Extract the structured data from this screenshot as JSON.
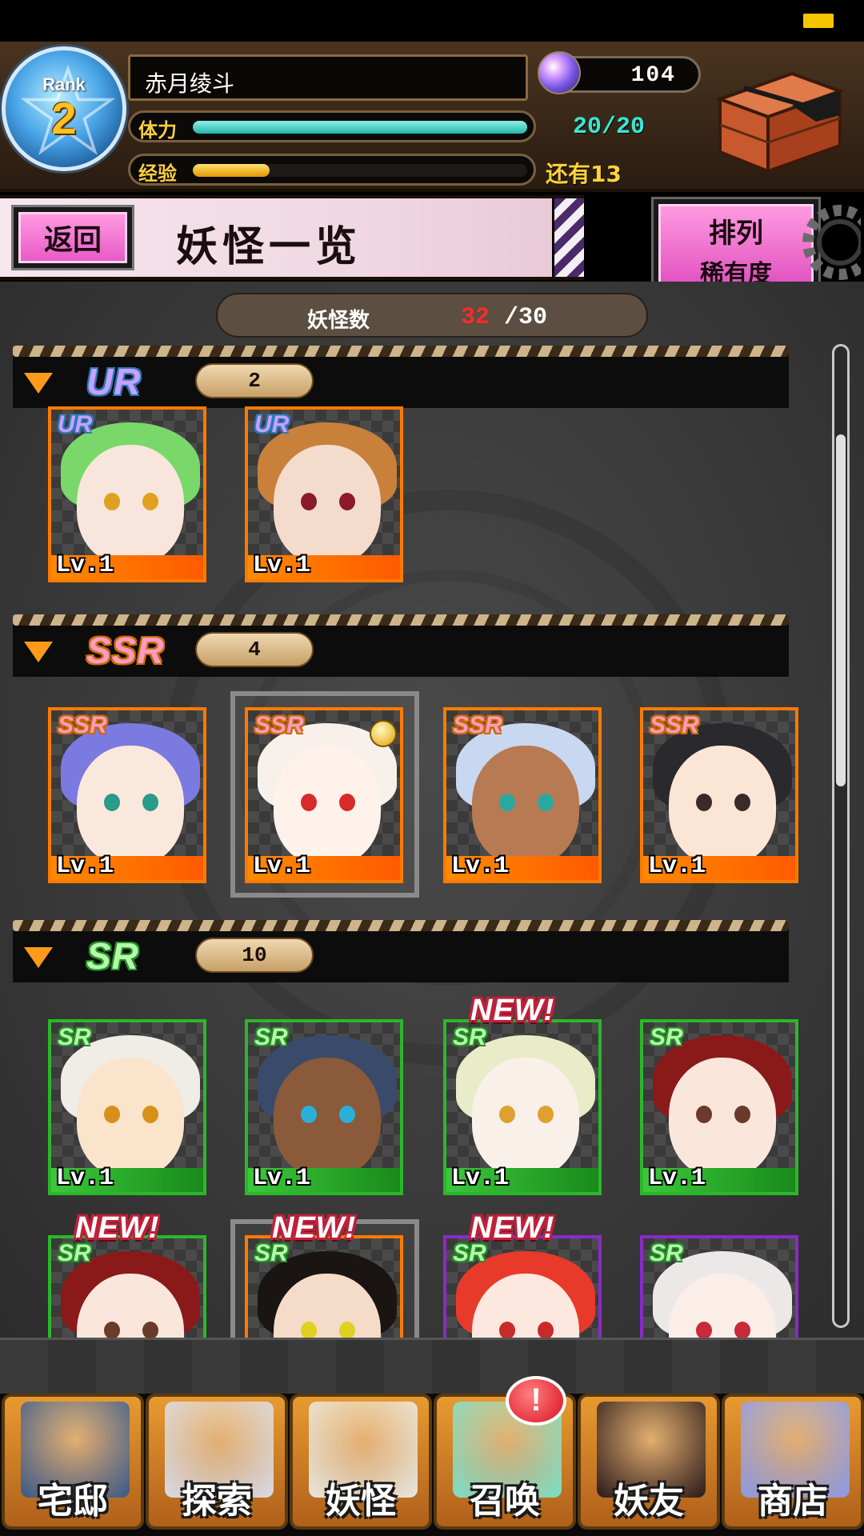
{
  "header": {
    "rank_label": "Rank",
    "rank_value": "2",
    "player_name": "赤月绫斗",
    "gems": "104",
    "stamina_label": "体力",
    "stamina_value": "20/20",
    "stamina_fraction": 1.0,
    "exp_label": "经验",
    "exp_remaining": "还有13",
    "exp_fraction": 0.23
  },
  "title_bar": {
    "back_label": "返回",
    "title": "妖怪一览",
    "sort_label": "排列",
    "sort_value": "稀有度"
  },
  "monster_count": {
    "label": "妖怪数",
    "current": "32",
    "max": "/30"
  },
  "sections": [
    {
      "rarity": "UR",
      "count": "2",
      "cards": [
        {
          "rarity": "UR",
          "level": "Lv.1",
          "hair": "#7ad86a",
          "skin": "#f8e6dc",
          "eye": "#e0a020"
        },
        {
          "rarity": "UR",
          "level": "Lv.1",
          "hair": "#c8803a",
          "skin": "#f4dccc",
          "eye": "#8a1a2a"
        }
      ]
    },
    {
      "rarity": "SSR",
      "count": "4",
      "cards": [
        {
          "rarity": "SSR",
          "level": "Lv.1",
          "hair": "#7a7ae0",
          "skin": "#fbe8dc",
          "eye": "#2a9a8a"
        },
        {
          "rarity": "SSR",
          "level": "Lv.1",
          "hair": "#f8f0ea",
          "skin": "#fff2ea",
          "eye": "#d82a2a"
        },
        {
          "rarity": "SSR",
          "level": "Lv.1",
          "hair": "#c8d8f0",
          "skin": "#b87a52",
          "eye": "#2aa8a0"
        },
        {
          "rarity": "SSR",
          "level": "Lv.1",
          "hair": "#2a2a2e",
          "skin": "#fbe6d6",
          "eye": "#3a2a2a"
        }
      ]
    },
    {
      "rarity": "SR",
      "count": "10",
      "cards": [
        {
          "rarity": "SR",
          "level": "Lv.1",
          "hair": "#f0ece6",
          "skin": "#fbe4cc",
          "eye": "#d8901a"
        },
        {
          "rarity": "SR",
          "level": "Lv.1",
          "hair": "#3a4a6a",
          "skin": "#8a5a3a",
          "eye": "#2ab0d8"
        },
        {
          "rarity": "SR",
          "level": "Lv.1",
          "hair": "#e8ecc8",
          "skin": "#faf0ea",
          "eye": "#e0a030"
        },
        {
          "rarity": "SR",
          "level": "Lv.1",
          "hair": "#8a1a1a",
          "skin": "#fbe6dc",
          "eye": "#6a3a2a"
        },
        {
          "rarity": "SR",
          "level": "",
          "hair": "#8a1a1a",
          "skin": "#fbe6dc",
          "eye": "#6a3a2a"
        },
        {
          "rarity": "SR",
          "level": "",
          "hair": "#1a1412",
          "skin": "#f4dcc8",
          "eye": "#e0d020"
        },
        {
          "rarity": "SR",
          "level": "",
          "hair": "#e83a2a",
          "skin": "#fde8e0",
          "eye": "#c82a2a"
        },
        {
          "rarity": "SR",
          "level": "",
          "hair": "#ece8e8",
          "skin": "#fbeee8",
          "eye": "#c82a3a"
        }
      ]
    }
  ],
  "new_badge": "NEW!",
  "nav": [
    {
      "label": "宅邸",
      "icon": "mansion-icon",
      "color": "#3a5a8a"
    },
    {
      "label": "探索",
      "icon": "magnifier-icon",
      "color": "#d8dce8"
    },
    {
      "label": "妖怪",
      "icon": "scroll-icon",
      "color": "#e8e8e0"
    },
    {
      "label": "召唤",
      "icon": "summon-star-icon",
      "color": "#7ae0c8"
    },
    {
      "label": "妖友",
      "icon": "friend-icon",
      "color": "#2a1a1a"
    },
    {
      "label": "商店",
      "icon": "crystal-orb-icon",
      "color": "#8a9ae8"
    }
  ],
  "alert_badge": "!",
  "colors": {
    "accent_pink": "#e85ac8",
    "stamina": "#23b5a8",
    "exp": "#e09800"
  }
}
